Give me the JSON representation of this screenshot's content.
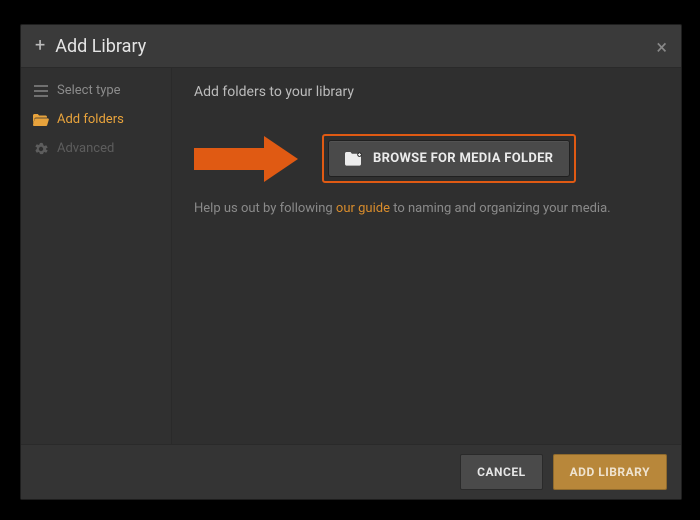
{
  "header": {
    "title": "Add Library"
  },
  "sidebar": {
    "items": [
      {
        "label": "Select type"
      },
      {
        "label": "Add folders"
      },
      {
        "label": "Advanced"
      }
    ]
  },
  "main": {
    "heading": "Add folders to your library",
    "browse_label": "BROWSE FOR MEDIA FOLDER",
    "help_prefix": "Help us out by following ",
    "help_link": "our guide",
    "help_suffix": " to naming and organizing your media."
  },
  "footer": {
    "cancel": "CANCEL",
    "add": "ADD LIBRARY"
  }
}
